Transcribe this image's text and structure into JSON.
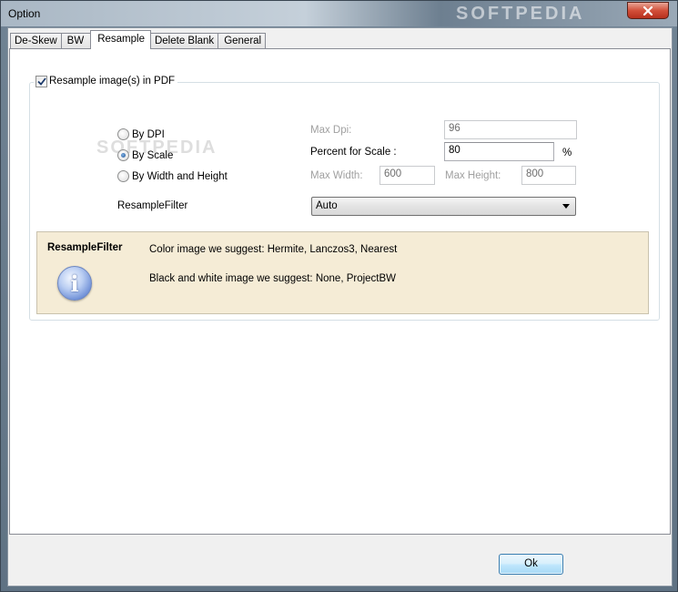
{
  "window": {
    "title": "Option",
    "watermark": "SOFTPEDIA"
  },
  "tabs": [
    {
      "label": "De-Skew",
      "active": false
    },
    {
      "label": "BW",
      "active": false
    },
    {
      "label": "Resample",
      "active": true
    },
    {
      "label": "Delete Blank",
      "active": false
    },
    {
      "label": "General",
      "active": false
    }
  ],
  "resample": {
    "enable_checkbox": {
      "label": "Resample image(s) in PDF",
      "checked": true
    },
    "modes": [
      {
        "label": "By DPI",
        "selected": false
      },
      {
        "label": "By Scale",
        "selected": true
      },
      {
        "label": "By Width and Height",
        "selected": false
      }
    ],
    "max_dpi": {
      "label": "Max Dpi:",
      "value": "96"
    },
    "percent_scale": {
      "label": "Percent for Scale :",
      "value": "80",
      "unit": "%"
    },
    "max_width": {
      "label": "Max Width:",
      "value": "600"
    },
    "max_height": {
      "label": "Max Height:",
      "value": "800"
    },
    "filter": {
      "label": "ResampleFilter",
      "selected": "Auto"
    }
  },
  "info": {
    "title": "ResampleFilter",
    "line1": "Color image we suggest: Hermite, Lanczos3, Nearest",
    "line2": "Black and white image we suggest: None, ProjectBW"
  },
  "footer": {
    "ok_label": "Ok"
  },
  "colors": {
    "info_background": "#f5ecd6",
    "close_button": "#c7432f",
    "ok_button": "#bee6fd"
  }
}
